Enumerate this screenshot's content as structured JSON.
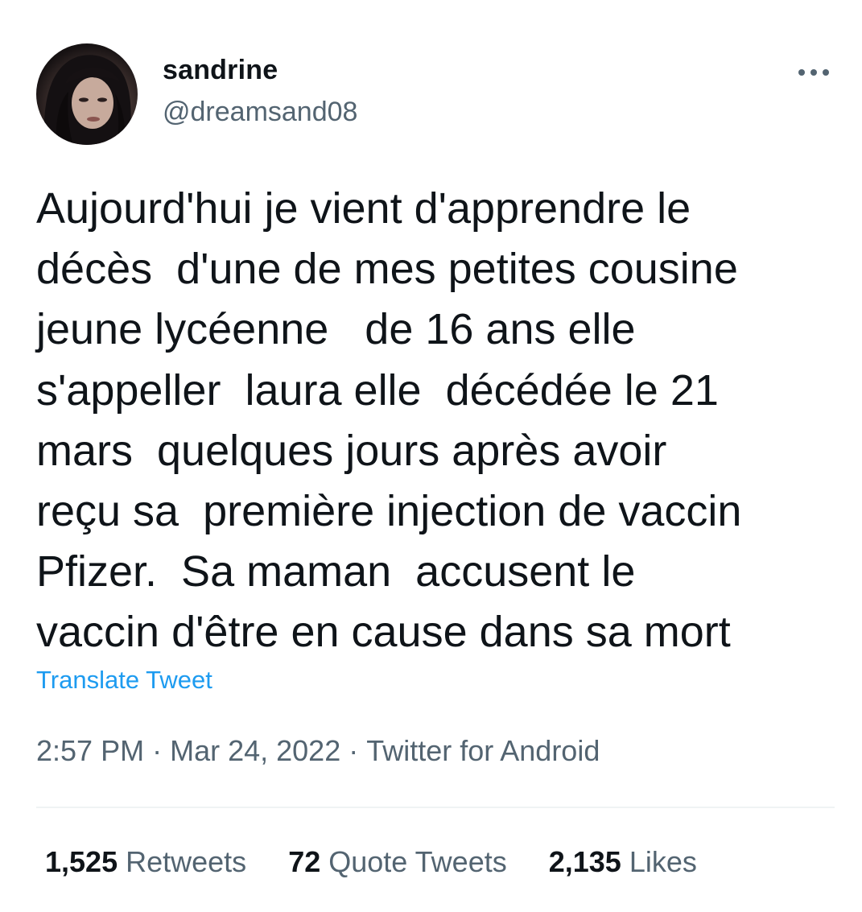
{
  "author": {
    "display_name": "sandrine",
    "handle": "@dreamsand08",
    "avatar_icon": "profile-photo"
  },
  "more_icon": "ellipsis-horizontal-icon",
  "tweet": {
    "text": "Aujourd'hui je vient d'apprendre le\ndécès  d'une de mes petites cousine\njeune lycéenne   de 16 ans elle\ns'appeller  laura elle  décédée le 21\nmars  quelques jours après avoir\nreçu sa  première injection de vaccin\nPfizer.  Sa maman  accusent le\nvaccin d'être en cause dans sa mort",
    "translate_label": "Translate Tweet",
    "time": "2:57 PM",
    "date": "Mar 24, 2022",
    "source": "Twitter for Android",
    "separator": "·"
  },
  "stats": {
    "retweets_count": "1,525",
    "retweets_label": "Retweets",
    "quotes_count": "72",
    "quotes_label": "Quote Tweets",
    "likes_count": "2,135",
    "likes_label": "Likes"
  },
  "colors": {
    "text_primary": "#0f1419",
    "text_secondary": "#536471",
    "link": "#1d9bf0",
    "divider": "#eff3f4"
  }
}
